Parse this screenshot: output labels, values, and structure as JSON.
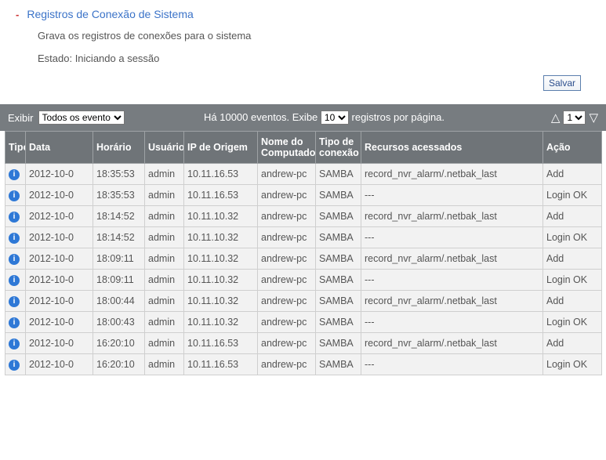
{
  "header": {
    "collapse_mark": "-",
    "title": "Registros de Conexão de Sistema",
    "description": "Grava os registros de conexões para o sistema",
    "status_label": "Estado: Iniciando a sessão",
    "save_label": "Salvar"
  },
  "toolbar": {
    "show_label": "Exibir",
    "filter_value": "Todos os evento",
    "events_text_prefix": "Há ",
    "events_count": "10000",
    "events_text_mid": " eventos.   Exibe ",
    "page_size_value": "10",
    "events_text_suffix": " registros por página.",
    "page_value": "1"
  },
  "table": {
    "headers": {
      "type": "Tipo",
      "date": "Data",
      "time": "Horário",
      "user": "Usuário",
      "ip": "IP de Origem",
      "host": "Nome do Computador",
      "conn": "Tipo de conexão",
      "res": "Recursos acessados",
      "act": "Ação"
    },
    "rows": [
      {
        "date": "2012-10-0",
        "time": "18:35:53",
        "user": "admin",
        "ip": "10.11.16.53",
        "host": "andrew-pc",
        "conn": "SAMBA",
        "res": "record_nvr_alarm/.netbak_last",
        "act": "Add"
      },
      {
        "date": "2012-10-0",
        "time": "18:35:53",
        "user": "admin",
        "ip": "10.11.16.53",
        "host": "andrew-pc",
        "conn": "SAMBA",
        "res": "---",
        "act": "Login OK"
      },
      {
        "date": "2012-10-0",
        "time": "18:14:52",
        "user": "admin",
        "ip": "10.11.10.32",
        "host": "andrew-pc",
        "conn": "SAMBA",
        "res": "record_nvr_alarm/.netbak_last",
        "act": "Add"
      },
      {
        "date": "2012-10-0",
        "time": "18:14:52",
        "user": "admin",
        "ip": "10.11.10.32",
        "host": "andrew-pc",
        "conn": "SAMBA",
        "res": "---",
        "act": "Login OK"
      },
      {
        "date": "2012-10-0",
        "time": "18:09:11",
        "user": "admin",
        "ip": "10.11.10.32",
        "host": "andrew-pc",
        "conn": "SAMBA",
        "res": "record_nvr_alarm/.netbak_last",
        "act": "Add"
      },
      {
        "date": "2012-10-0",
        "time": "18:09:11",
        "user": "admin",
        "ip": "10.11.10.32",
        "host": "andrew-pc",
        "conn": "SAMBA",
        "res": "---",
        "act": "Login OK"
      },
      {
        "date": "2012-10-0",
        "time": "18:00:44",
        "user": "admin",
        "ip": "10.11.10.32",
        "host": "andrew-pc",
        "conn": "SAMBA",
        "res": "record_nvr_alarm/.netbak_last",
        "act": "Add"
      },
      {
        "date": "2012-10-0",
        "time": "18:00:43",
        "user": "admin",
        "ip": "10.11.10.32",
        "host": "andrew-pc",
        "conn": "SAMBA",
        "res": "---",
        "act": "Login OK"
      },
      {
        "date": "2012-10-0",
        "time": "16:20:10",
        "user": "admin",
        "ip": "10.11.16.53",
        "host": "andrew-pc",
        "conn": "SAMBA",
        "res": "record_nvr_alarm/.netbak_last",
        "act": "Add"
      },
      {
        "date": "2012-10-0",
        "time": "16:20:10",
        "user": "admin",
        "ip": "10.11.16.53",
        "host": "andrew-pc",
        "conn": "SAMBA",
        "res": "---",
        "act": "Login OK"
      }
    ]
  }
}
